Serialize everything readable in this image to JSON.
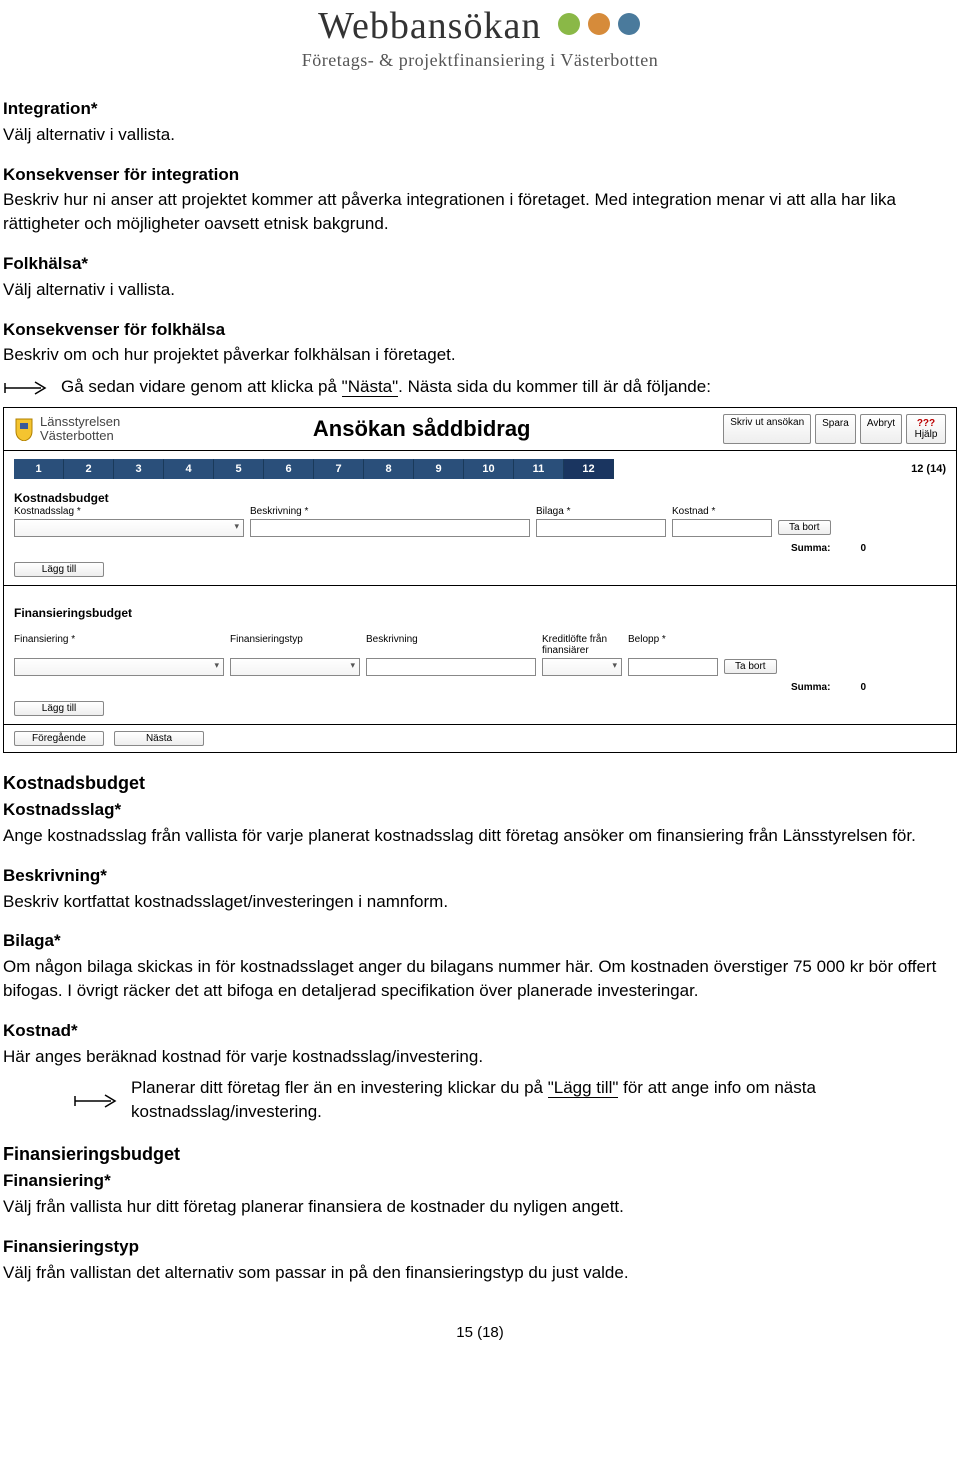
{
  "logo": {
    "title": "Webbansökan",
    "subtitle": "Företags- & projektfinansiering i Västerbotten"
  },
  "doc": {
    "s1_h": "Integration*",
    "s1_p": "Välj alternativ i vallista.",
    "s2_h": "Konsekvenser för integration",
    "s2_p": "Beskriv hur ni anser att projektet kommer att påverka integrationen i företaget. Med integration menar vi att alla har lika rättigheter och möjligheter oavsett etnisk bakgrund.",
    "s3_h": "Folkhälsa*",
    "s3_p": "Välj alternativ i vallista.",
    "s4_h": "Konsekvenser för folkhälsa",
    "s4_p": "Beskriv om och hur projektet påverkar folkhälsan i företaget.",
    "arrow1_a": "Gå sedan vidare genom att klicka på ",
    "arrow1_b": "\"Nästa\"",
    "arrow1_c": ". Nästa sida du kommer till är då följande:",
    "s5_title": "Kostnadsbudget",
    "s5_h": "Kostnadsslag*",
    "s5_p": "Ange kostnadsslag från vallista för varje planerat kostnadsslag ditt företag ansöker om finansiering från Länsstyrelsen för.",
    "s6_h": "Beskrivning*",
    "s6_p": "Beskriv kortfattat kostnadsslaget/investeringen i namnform.",
    "s7_h": "Bilaga*",
    "s7_p": "Om någon bilaga skickas in för kostnadsslaget anger du bilagans nummer här. Om kostnaden överstiger 75 000 kr bör offert bifogas. I övrigt räcker det att bifoga en detaljerad specifikation över planerade investeringar.",
    "s8_h": "Kostnad*",
    "s8_p": "Här anges beräknad kostnad för varje kostnadsslag/investering.",
    "arrow2_a": "Planerar ditt företag fler än en investering klickar du på ",
    "arrow2_b": "\"Lägg till\"",
    "arrow2_c": " för att ange info om nästa kostnadsslag/investering.",
    "s9_title": "Finansieringsbudget",
    "s9_h": "Finansiering*",
    "s9_p": "Välj från vallista hur ditt företag planerar finansiera de kostnader du nyligen angett.",
    "s10_h": "Finansieringstyp",
    "s10_p": "Välj från vallistan det alternativ som passar in på den finansieringstyp du just valde.",
    "pagenum": "15 (18)"
  },
  "app": {
    "agency1": "Länsstyrelsen",
    "agency2": "Västerbotten",
    "title": "Ansökan såddbidrag",
    "btn_print": "Skriv ut ansökan",
    "btn_save": "Spara",
    "btn_cancel": "Avbryt",
    "btn_help_q": "???",
    "btn_help": "Hjälp",
    "steps": [
      "1",
      "2",
      "3",
      "4",
      "5",
      "6",
      "7",
      "8",
      "9",
      "10",
      "11",
      "12"
    ],
    "step_count": "12 (14)",
    "kost_title": "Kostnadsbudget",
    "kost_lbl1": "Kostnadsslag *",
    "kost_lbl2": "Beskrivning *",
    "kost_lbl3": "Bilaga *",
    "kost_lbl4": "Kostnad *",
    "btn_tabort": "Ta bort",
    "summa_lbl": "Summa:",
    "summa_val": "0",
    "btn_lagg": "Lägg till",
    "fin_title": "Finansieringsbudget",
    "fin_lbl1": "Finansiering *",
    "fin_lbl2": "Finansieringstyp",
    "fin_lbl3": "Beskrivning",
    "fin_lbl4": "Kreditlöfte från finansiärer",
    "fin_lbl5": "Belopp *",
    "btn_prev": "Föregående",
    "btn_next": "Nästa"
  }
}
